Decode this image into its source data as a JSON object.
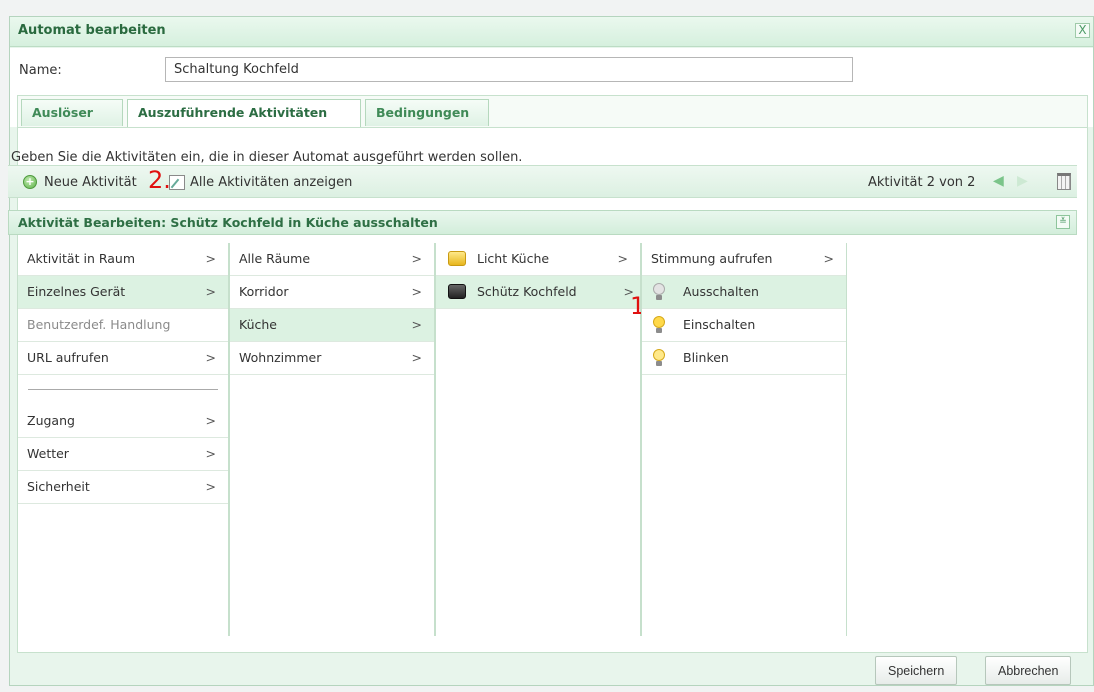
{
  "window": {
    "title": "Automat bearbeiten",
    "close_label": "X"
  },
  "name_field": {
    "label": "Name:",
    "value": "Schaltung Kochfeld"
  },
  "tabs": [
    {
      "label": "Auslöser"
    },
    {
      "label": "Auszuführende Aktivitäten"
    },
    {
      "label": "Bedingungen"
    }
  ],
  "description": "Geben Sie die Aktivitäten ein, die in dieser Automat ausgeführt werden sollen.",
  "toolbar": {
    "new_label": "Neue Aktivität",
    "show_all_label": "Alle Aktivitäten anzeigen",
    "count_label": "Aktivität 2 von 2",
    "prev_icon": "arrow-left-icon",
    "next_icon": "arrow-right-icon",
    "delete_icon": "trash-icon"
  },
  "annotations": {
    "marker_1": "1.",
    "marker_2": "2."
  },
  "edit_panel": {
    "title": "Aktivität Bearbeiten: Schütz Kochfeld in Küche ausschalten",
    "collapse_icon": "double-chevron-down-icon"
  },
  "columns": {
    "col1": [
      {
        "label": "Aktivität in Raum",
        "arrow": ">"
      },
      {
        "label": "Einzelnes Gerät",
        "arrow": ">"
      },
      {
        "label": "Benutzerdef. Handlung",
        "arrow": ""
      },
      {
        "label": "URL aufrufen",
        "arrow": ">"
      },
      {
        "label": "Zugang",
        "arrow": ">"
      },
      {
        "label": "Wetter",
        "arrow": ">"
      },
      {
        "label": "Sicherheit",
        "arrow": ">"
      }
    ],
    "col2": [
      {
        "label": "Alle Räume",
        "arrow": ">"
      },
      {
        "label": "Korridor",
        "arrow": ">"
      },
      {
        "label": "Küche",
        "arrow": ">"
      },
      {
        "label": "Wohnzimmer",
        "arrow": ">"
      }
    ],
    "col3": [
      {
        "label": "Licht Küche",
        "arrow": ">",
        "icon": "light-box-icon"
      },
      {
        "label": "Schütz Kochfeld",
        "arrow": ">",
        "icon": "contactor-icon"
      }
    ],
    "col4": [
      {
        "label": "Stimmung aufrufen",
        "arrow": ">"
      },
      {
        "label": "Ausschalten",
        "icon": "bulb-off-icon"
      },
      {
        "label": "Einschalten",
        "icon": "bulb-on-icon"
      },
      {
        "label": "Blinken",
        "icon": "bulb-blink-icon"
      }
    ]
  },
  "colors": {
    "accent": "#2e6f44",
    "selected_bg": "#dcf2e2",
    "marker": "#e01010"
  },
  "buttons": {
    "save": "Speichern",
    "cancel": "Abbrechen"
  }
}
